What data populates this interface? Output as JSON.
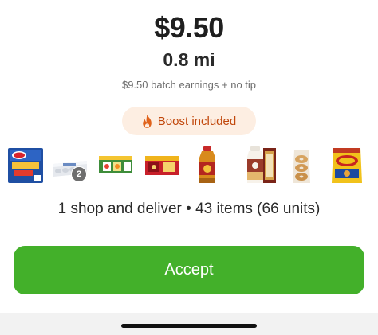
{
  "offer": {
    "price": "$9.50",
    "distance": "0.8 mi",
    "earnings_note": "$9.50 batch earnings + no tip",
    "boost_label": "Boost included",
    "summary": "1 shop and deliver • 43 items (66 units)"
  },
  "items": [
    {
      "icon": "cheese-singles-icon"
    },
    {
      "icon": "egg-carton-icon",
      "quantity": "2"
    },
    {
      "icon": "juice-box-pack-icon"
    },
    {
      "icon": "fruit-snacks-box-icon"
    },
    {
      "icon": "apple-juice-bottle-icon"
    },
    {
      "icon": "coffee-creamer-bottle-icon"
    },
    {
      "icon": "hazelnut-box-icon"
    },
    {
      "icon": "bagels-bag-icon"
    },
    {
      "icon": "fritos-chips-icon"
    }
  ],
  "actions": {
    "accept_label": "Accept"
  },
  "colors": {
    "accent_green": "#43b02a",
    "boost_background": "#fdeee2",
    "boost_text": "#c1470b"
  }
}
